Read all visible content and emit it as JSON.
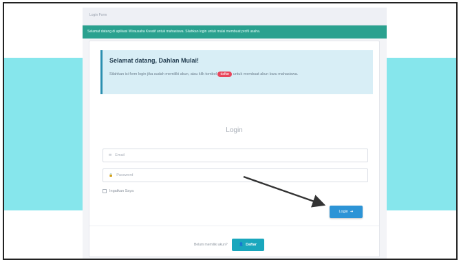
{
  "topbar": {
    "text": "Login Form"
  },
  "notice": {
    "text": "Selamat datang di aplikasi Wirausaha Kreatif untuk mahasiswa. Silahkan login untuk mulai membuat profil usaha."
  },
  "welcome": {
    "title": "Selamat datang, Dahlan Mulai!",
    "text_before": "Silahkan isi form login jika sudah memiliki akun, atau klik tombol",
    "highlight": "daftar",
    "text_after": "untuk membuat akun baru mahasiswa."
  },
  "login": {
    "heading": "Login",
    "email_placeholder": "Email",
    "password_placeholder": "Password",
    "remember_label": "Ingatkan Saya",
    "button_label": "Login"
  },
  "register": {
    "prompt": "Belum memiliki akun?",
    "button_label": "Daftar"
  },
  "icons": {
    "email": "envelope-icon",
    "password": "lock-icon",
    "login_arrow": "arrow-right-icon",
    "register_user": "user-plus-icon"
  },
  "colors": {
    "notice_bar": "#2aa18f",
    "welcome_box": "#d8eef6",
    "login_button": "#2d94d6",
    "register_button": "#1aa7bd",
    "highlight": "#e8465c",
    "background_band": "#86e6ec"
  }
}
